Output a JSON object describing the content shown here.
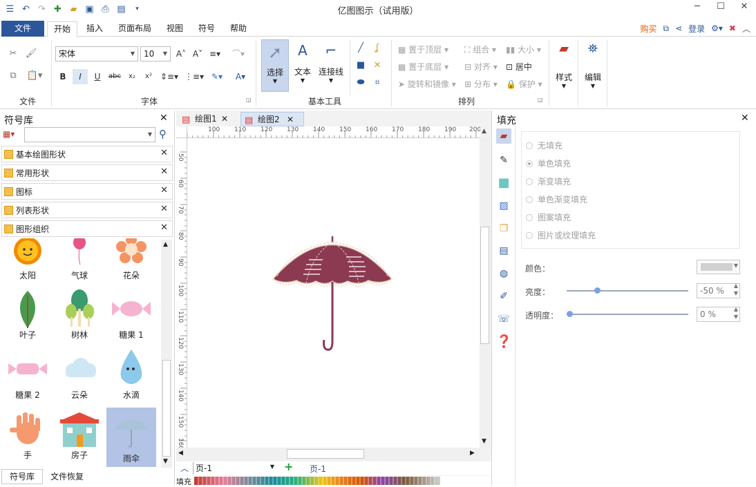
{
  "app": {
    "title": "亿图图示（试用版）"
  },
  "menu": {
    "file": "文件",
    "tabs": [
      "开始",
      "插入",
      "页面布局",
      "视图",
      "符号",
      "帮助"
    ],
    "buy": "购买",
    "login": "登录"
  },
  "ribbon": {
    "groups": {
      "file": "文件",
      "font": "字体",
      "basic_tools": "基本工具",
      "arrange": "排列"
    },
    "font_name": "宋体",
    "font_size": "10",
    "tools": {
      "select": "选择",
      "text": "文本",
      "connector": "连接线"
    },
    "arrange": {
      "bring_front": "置于顶层",
      "send_back": "置于底层",
      "rotate_mirror": "旋转和镜像",
      "group": "组合",
      "align": "对齐",
      "distribute": "分布",
      "size": "大小",
      "center": "居中",
      "protect": "保护"
    },
    "style": "样式",
    "edit": "编辑"
  },
  "left_panel": {
    "title": "符号库",
    "libraries": [
      "基本绘图形状",
      "常用形状",
      "图标",
      "列表形状",
      "图形组织"
    ],
    "shapes": [
      "太阳",
      "气球",
      "花朵",
      "叶子",
      "树林",
      "糖果 1",
      "糖果 2",
      "云朵",
      "水滴",
      "手",
      "房子",
      "雨伞"
    ],
    "bottom_tabs": [
      "符号库",
      "文件恢复"
    ]
  },
  "canvas": {
    "tabs": [
      "绘图1",
      "绘图2"
    ],
    "ruler_top": [
      "100",
      "110",
      "120",
      "130",
      "140",
      "150",
      "160",
      "170",
      "180",
      "190",
      "200"
    ],
    "ruler_left": [
      "50",
      "60",
      "70",
      "80",
      "90",
      "100",
      "110",
      "120",
      "130",
      "140",
      "150",
      "160"
    ],
    "page_selector": "页-1",
    "page_tab": "页-1",
    "fill_label": "填充"
  },
  "right_panel": {
    "title": "填充",
    "options": [
      "无填充",
      "单色填充",
      "渐变填充",
      "单色渐变填充",
      "图案填充",
      "图片或纹理填充"
    ],
    "selected_option": "单色填充",
    "color_label": "颜色：",
    "brightness_label": "亮度：",
    "brightness_value": "-50 %",
    "brightness_level": 0.25,
    "transparency_label": "透明度：",
    "transparency_value": "0 %",
    "transparency_level": 0
  },
  "colors": {
    "accent": "#2b579a",
    "umbrella": "#8b3a52",
    "buy": "#e05a00"
  }
}
